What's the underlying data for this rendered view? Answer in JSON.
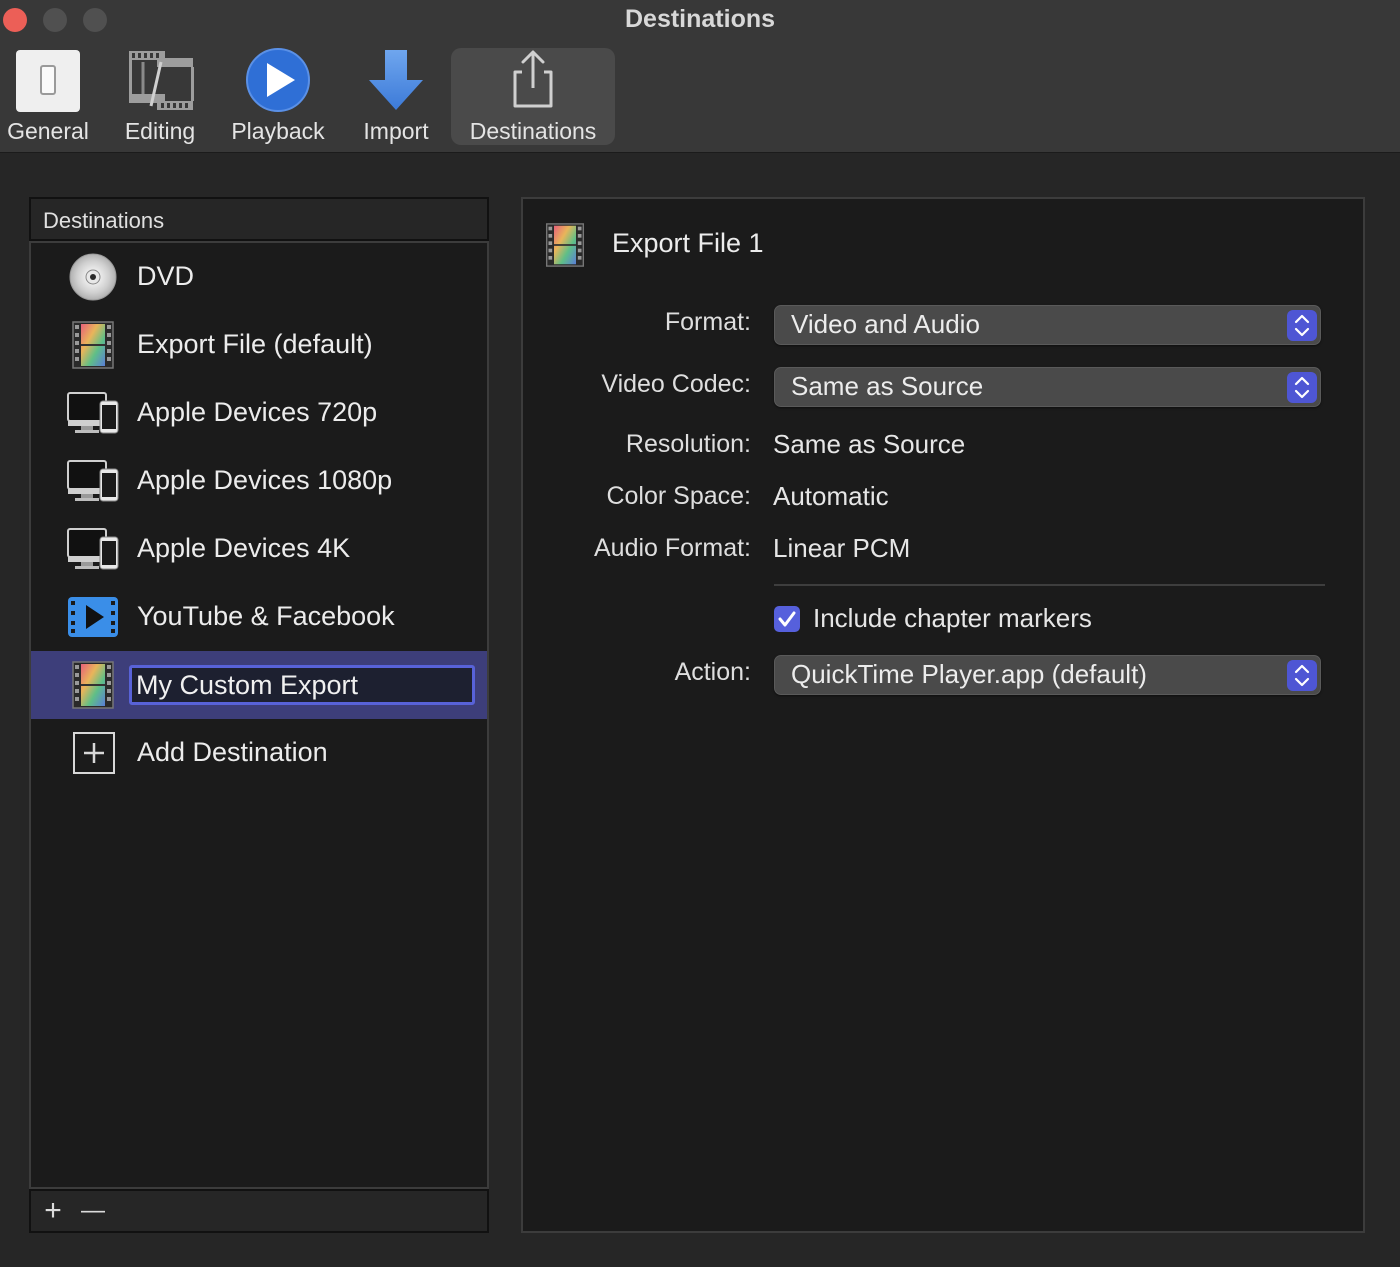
{
  "window": {
    "title": "Destinations",
    "traffic_lights": [
      "close",
      "minimize",
      "zoom"
    ]
  },
  "toolbar": {
    "items": [
      {
        "label": "General",
        "icon": "switch-icon"
      },
      {
        "label": "Editing",
        "icon": "film-editing-icon"
      },
      {
        "label": "Playback",
        "icon": "play-circle-icon"
      },
      {
        "label": "Import",
        "icon": "down-arrow-icon"
      },
      {
        "label": "Destinations",
        "icon": "share-icon",
        "selected": true
      }
    ]
  },
  "sidebar": {
    "header": "Destinations",
    "items": [
      {
        "label": "DVD",
        "icon": "dvd-icon"
      },
      {
        "label": "Export File (default)",
        "icon": "film-color-icon"
      },
      {
        "label": "Apple Devices 720p",
        "icon": "apple-devices-icon"
      },
      {
        "label": "Apple Devices 1080p",
        "icon": "apple-devices-icon"
      },
      {
        "label": "Apple Devices 4K",
        "icon": "apple-devices-icon"
      },
      {
        "label": "YouTube & Facebook",
        "icon": "video-play-icon"
      },
      {
        "label": "My Custom Export",
        "icon": "film-color-icon",
        "selected": true,
        "editing": true
      },
      {
        "label": "Add Destination",
        "icon": "plus-box-icon"
      }
    ],
    "footer": {
      "add": "+",
      "remove": "—"
    }
  },
  "detail": {
    "title": "Export File 1",
    "format_label": "Format:",
    "format_value": "Video and Audio",
    "codec_label": "Video Codec:",
    "codec_value": "Same as Source",
    "resolution_label": "Resolution:",
    "resolution_value": "Same as Source",
    "colorspace_label": "Color Space:",
    "colorspace_value": "Automatic",
    "audio_label": "Audio Format:",
    "audio_value": "Linear PCM",
    "chapter_label": "Include chapter markers",
    "chapter_checked": true,
    "action_label": "Action:",
    "action_value": "QuickTime Player.app (default)"
  },
  "colors": {
    "accent": "#5660dc",
    "selection": "#3d3e7a",
    "window_bg": "#262626",
    "panel_bg": "#1b1b1b"
  }
}
